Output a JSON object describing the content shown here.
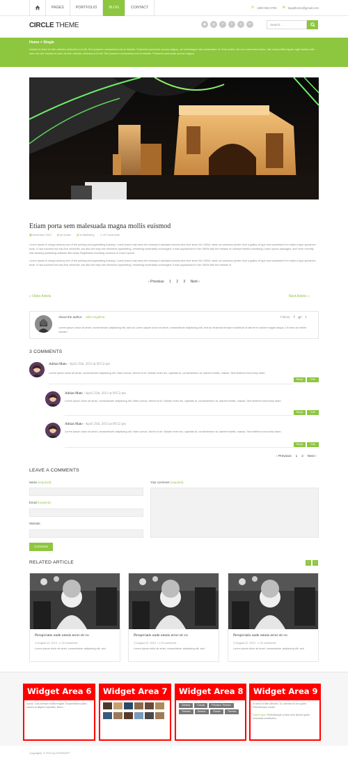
{
  "nav": {
    "items": [
      {
        "label": "Pages"
      },
      {
        "label": "Portfolio"
      },
      {
        "label": "Blog"
      },
      {
        "label": "Contact"
      }
    ],
    "active_index": 2,
    "phone": "1800-562-3784",
    "email": "kopatheme@gmail.com"
  },
  "header": {
    "logo_bold": "CIRCLE",
    "logo_light": " THEME",
    "search_placeholder": "Search...",
    "social_icons": [
      "rss-icon",
      "dribbble-icon",
      "facebook-icon",
      "twitter-icon",
      "vimeo-icon",
      "flickr-icon"
    ]
  },
  "banner": {
    "breadcrumb": "Home  >  Single",
    "text": "Nullam id dolor id nibh ultricies vehicula ut id elit. Sed posuere consectetur est at lobortis. Praesent commodo cursus magna, vel scelerisque nisl consectetur et. Duis mollis, est non commodo luctus, nisi erat porttitor ligula, eget lacinia odio sem nec elit. Nullam id dolor id nibh ultricies vehicula ut id elit. Sed posuere consectetur est at lobortis. Praesent commodo cursus magna."
  },
  "post": {
    "title": "Etiam porta sem malesuada magna mollis euismod",
    "date": "December 2013",
    "author": "by Susan",
    "category": "In Marketing",
    "comments": "20 Comments",
    "para1": "Lorem Ipsum is simply dummy text of the printing and typesetting industry. Lorem Ipsum has been the industry's standard dummy text ever since the 1500s, when an unknown printer took a galley of type and scrambled it to make a type specimen book. It has survived not only five centuries, but also the leap into electronic typesetting, remaining essentially unchanged. It was popularised in the 1960s with the release of Letraset sheets containing Lorem Ipsum passages, and more recently with desktop publishing software like Aldus PageMaker including versions of Lorem Ipsum.",
    "para2": "Lorem Ipsum is simply dummy text of the printing and typesetting industry. Lorem Ipsum has been the industry's standard dummy text ever since the 1500s, when an unknown printer took a galley of type and scrambled it to make a type specimen book. It has survived not only five centuries, but also the leap into electronic typesetting, remaining essentially unchanged. It was popularised in the 1960s with the release of"
  },
  "pager": {
    "prev": "‹ Previous",
    "pages": [
      "1",
      "2",
      "3"
    ],
    "next": "Next ›"
  },
  "post_nav": {
    "older": "« Older Article",
    "newer": "Next Article »"
  },
  "author_box": {
    "label": "About the author:",
    "name": "Jolie Angelina",
    "follow": "Follow:",
    "bio": "Lorem ipsum dolor sit amet, consectetuer adipiscing elit, sed do Lorem ipsum dolor sit amet, consectetuer adipiscing elit, sed do eiusmod tempor incididunt ut labore et dolore magna aliqua. Ut enim ad minim veniam."
  },
  "comments": {
    "heading": "3 COMMENTS",
    "items": [
      {
        "name": "Adrian Mato",
        "date": " - April 25th, 2013 at 09:52 pm",
        "text": "Lorem ipsum dolor sit amet, consectetuer adipiscing elit. Nam cursus. Morbi ut mi. Nullam enim leo, egestas id, condimentum at, laoreet mattis, massa. Sed eleifend nonummy diam."
      },
      {
        "name": "Adrian Mato",
        "date": " - April 25th, 2013 at 09:52 pm",
        "text": "Lorem ipsum dolor sit amet, consectetuer adipiscing elit. Nam cursus. Morbi ut mi. Nullam enim leo, egestas id, condimentum at, laoreet mattis, massa. Sed eleifend nonummy diam."
      },
      {
        "name": "Adrian Mato",
        "date": " - April 25th, 2013 at 09:52 pm",
        "text": "Lorem ipsum dolor sit amet, consectetuer adipiscing elit. Nam cursus. Morbi ut mi. Nullam enim leo, egestas id, condimentum at, laoreet mattis, massa. Sed eleifend nonummy diam."
      }
    ],
    "reply": "Reply",
    "edit": "Edit",
    "pager_prev": "‹ Previous",
    "pager_pages": [
      "1",
      "2"
    ],
    "pager_next": "Next ›"
  },
  "form": {
    "heading": "LEAVE A COMMENTS",
    "name_label": "Name",
    "email_label": "Email",
    "website_label": "Website:",
    "comment_label": "Your comment",
    "required": "(required):",
    "submit": "Comment"
  },
  "related": {
    "heading": "RELATED ARTICLE",
    "cards": [
      {
        "title": "Perspiciatis unde omnis error sit vo",
        "date": "August 22, 2013",
        "comments": "20 comments",
        "text": "Lorem ipsum dolor sit amet, consectetuer adipiscing elit, sed"
      },
      {
        "title": "Perspiciatis unde omnis error sit vo",
        "date": "August 22, 2013",
        "comments": "20 comments",
        "text": "Lorem ipsum dolor sit amet, consectetuer adipiscing elit, sed"
      },
      {
        "title": "Perspiciatis unde omnis error sit vo",
        "date": "August 22, 2013",
        "comments": "20 comments",
        "text": "Lorem ipsum dolor sit amet, consectetuer adipiscing elit, sed"
      }
    ]
  },
  "footer": {
    "widgets": [
      {
        "title": "Widget Area 6",
        "text": "luctus. Cras semper mollis feugiat. Suspendisse quam, massa at aliquet vulputate, libero..."
      },
      {
        "title": "Widget Area 7"
      },
      {
        "title": "Widget Area 8",
        "tags": [
          "Generic",
          "Clouds",
          "Premium Themes",
          "Themes",
          "Generic",
          "Clouds",
          "Themes"
        ]
      },
      {
        "title": "Widget Area 9",
        "text1": "id dolor id nibh ultricies. Ut. Aenean eu leo quam. Pellentesque ornare",
        "text2": "Pellentesque ornare sem lacinia quam venenatis vestibulum.",
        "name": "Gianni says:"
      }
    ],
    "copyright": "Copyrights. © 2013 by KOPASOFT"
  },
  "colors": {
    "accent": "#8dc63f",
    "widget_red": "#ff0000"
  }
}
